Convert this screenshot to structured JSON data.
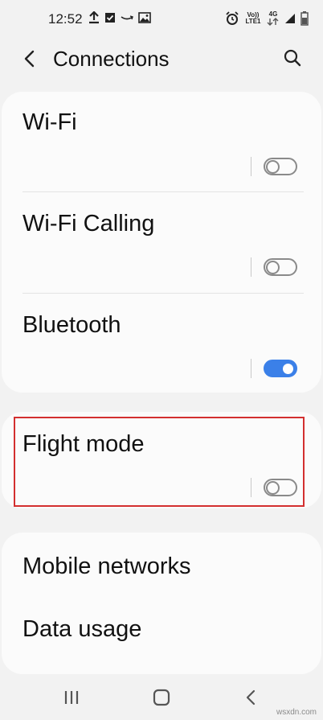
{
  "status_bar": {
    "time": "12:52",
    "left_icons": [
      "upload-icon",
      "checkbox-icon",
      "amazon-icon",
      "image-icon"
    ],
    "right_icons": [
      "alarm-icon",
      "volte-icon",
      "4g-signal-icon",
      "battery-icon"
    ],
    "volte_text": "Vo)) LTE1",
    "network_text": "4G"
  },
  "header": {
    "title": "Connections"
  },
  "settings": [
    {
      "label": "Wi-Fi",
      "toggle": "off"
    },
    {
      "label": "Wi-Fi Calling",
      "toggle": "off"
    },
    {
      "label": "Bluetooth",
      "toggle": "on"
    },
    {
      "label": "Flight mode",
      "toggle": "off"
    },
    {
      "label": "Mobile networks"
    },
    {
      "label": "Data usage"
    }
  ],
  "nav_bar": {
    "icons": [
      "recent-apps-icon",
      "home-icon",
      "back-icon"
    ]
  },
  "watermark": "wsxdn.com",
  "colors": {
    "accent": "#3b80e8",
    "highlight": "#d32f2f"
  }
}
